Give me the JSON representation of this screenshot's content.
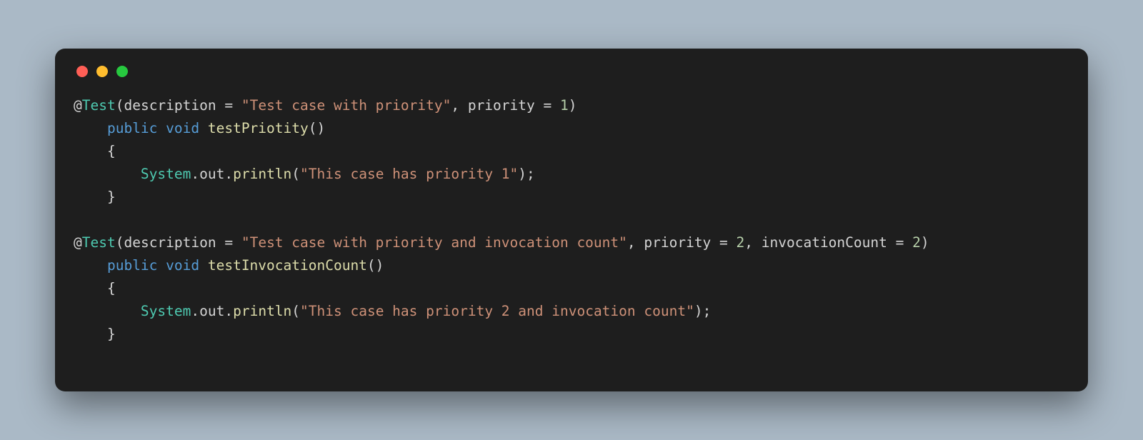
{
  "code": {
    "lines": [
      {
        "indent": "",
        "raw": [
          {
            "cls": "c-ann",
            "t": "@"
          },
          {
            "cls": "c-type",
            "t": "Test"
          },
          {
            "cls": "c-punc",
            "t": "("
          },
          {
            "cls": "c-param",
            "t": "description "
          },
          {
            "cls": "c-punc",
            "t": "= "
          },
          {
            "cls": "c-string",
            "t": "\"Test case with priority\""
          },
          {
            "cls": "c-punc",
            "t": ", "
          },
          {
            "cls": "c-param",
            "t": "priority "
          },
          {
            "cls": "c-punc",
            "t": "= "
          },
          {
            "cls": "c-num",
            "t": "1"
          },
          {
            "cls": "c-punc",
            "t": ")"
          }
        ]
      },
      {
        "indent": "    ",
        "raw": [
          {
            "cls": "c-kw",
            "t": "public void"
          },
          {
            "cls": "c-punc",
            "t": " "
          },
          {
            "cls": "c-func",
            "t": "testPriotity"
          },
          {
            "cls": "c-punc",
            "t": "()"
          }
        ]
      },
      {
        "indent": "    ",
        "raw": [
          {
            "cls": "c-punc",
            "t": "{"
          }
        ]
      },
      {
        "indent": "        ",
        "raw": [
          {
            "cls": "c-obj",
            "t": "System"
          },
          {
            "cls": "c-punc",
            "t": "."
          },
          {
            "cls": "c-field",
            "t": "out"
          },
          {
            "cls": "c-punc",
            "t": "."
          },
          {
            "cls": "c-func",
            "t": "println"
          },
          {
            "cls": "c-punc",
            "t": "("
          },
          {
            "cls": "c-string",
            "t": "\"This case has priority 1\""
          },
          {
            "cls": "c-punc",
            "t": ");"
          }
        ]
      },
      {
        "indent": "    ",
        "raw": [
          {
            "cls": "c-punc",
            "t": "}"
          }
        ]
      },
      {
        "indent": "",
        "raw": [
          {
            "cls": "c-punc",
            "t": ""
          }
        ]
      },
      {
        "indent": "",
        "raw": [
          {
            "cls": "c-ann",
            "t": "@"
          },
          {
            "cls": "c-type",
            "t": "Test"
          },
          {
            "cls": "c-punc",
            "t": "("
          },
          {
            "cls": "c-param",
            "t": "description "
          },
          {
            "cls": "c-punc",
            "t": "= "
          },
          {
            "cls": "c-string",
            "t": "\"Test case with priority and invocation count\""
          },
          {
            "cls": "c-punc",
            "t": ", "
          },
          {
            "cls": "c-param",
            "t": "priority "
          },
          {
            "cls": "c-punc",
            "t": "= "
          },
          {
            "cls": "c-num",
            "t": "2"
          },
          {
            "cls": "c-punc",
            "t": ", "
          },
          {
            "cls": "c-param",
            "t": "invocationCount "
          },
          {
            "cls": "c-punc",
            "t": "= "
          },
          {
            "cls": "c-num",
            "t": "2"
          },
          {
            "cls": "c-punc",
            "t": ")"
          }
        ]
      },
      {
        "indent": "    ",
        "raw": [
          {
            "cls": "c-kw",
            "t": "public void"
          },
          {
            "cls": "c-punc",
            "t": " "
          },
          {
            "cls": "c-func",
            "t": "testInvocationCount"
          },
          {
            "cls": "c-punc",
            "t": "()"
          }
        ]
      },
      {
        "indent": "    ",
        "raw": [
          {
            "cls": "c-punc",
            "t": "{"
          }
        ]
      },
      {
        "indent": "        ",
        "raw": [
          {
            "cls": "c-obj",
            "t": "System"
          },
          {
            "cls": "c-punc",
            "t": "."
          },
          {
            "cls": "c-field",
            "t": "out"
          },
          {
            "cls": "c-punc",
            "t": "."
          },
          {
            "cls": "c-func",
            "t": "println"
          },
          {
            "cls": "c-punc",
            "t": "("
          },
          {
            "cls": "c-string",
            "t": "\"This case has priority 2 and invocation count\""
          },
          {
            "cls": "c-punc",
            "t": ");"
          }
        ]
      },
      {
        "indent": "    ",
        "raw": [
          {
            "cls": "c-punc",
            "t": "}"
          }
        ]
      }
    ]
  }
}
